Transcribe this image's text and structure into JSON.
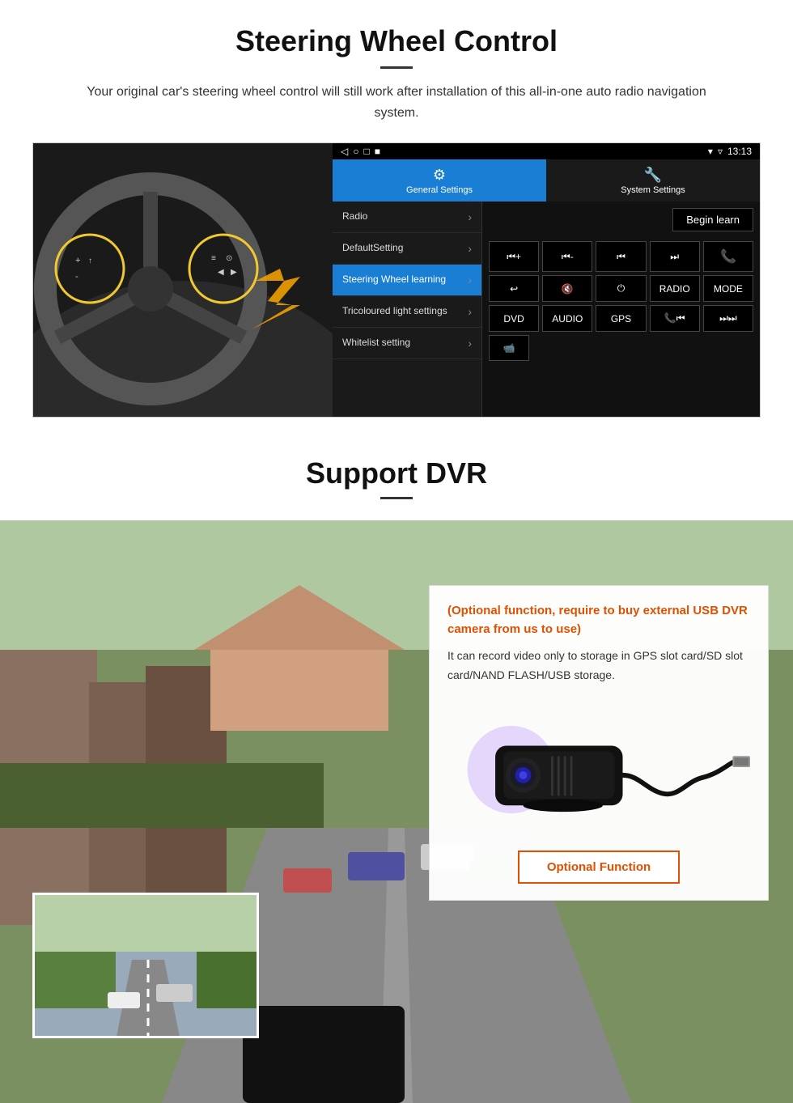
{
  "steering": {
    "title": "Steering Wheel Control",
    "description": "Your original car's steering wheel control will still work after installation of this all-in-one auto radio navigation system.",
    "status_bar": {
      "time": "13:13",
      "signal": "▼",
      "wifi": "▾"
    },
    "tabs": [
      {
        "id": "general",
        "label": "General Settings",
        "icon": "⚙",
        "active": true
      },
      {
        "id": "system",
        "label": "System Settings",
        "icon": "🔧",
        "active": false
      }
    ],
    "menu_items": [
      {
        "label": "Radio",
        "active": false
      },
      {
        "label": "DefaultSetting",
        "active": false
      },
      {
        "label": "Steering Wheel learning",
        "active": true
      },
      {
        "label": "Tricoloured light settings",
        "active": false
      },
      {
        "label": "Whitelist setting",
        "active": false
      }
    ],
    "begin_learn_label": "Begin learn",
    "control_buttons": [
      [
        "⏮+",
        "⏮-",
        "⏮",
        "⏭",
        "📞"
      ],
      [
        "↩",
        "🔇x",
        "⏻",
        "RADIO",
        "MODE"
      ],
      [
        "DVD",
        "AUDIO",
        "GPS",
        "📞⏮",
        "⏭⏭"
      ],
      [
        "📹"
      ]
    ]
  },
  "dvr": {
    "title": "Support DVR",
    "optional_heading": "(Optional function, require to buy external USB DVR camera from us to use)",
    "description": "It can record video only to storage in GPS slot card/SD slot card/NAND FLASH/USB storage.",
    "optional_function_label": "Optional Function"
  }
}
